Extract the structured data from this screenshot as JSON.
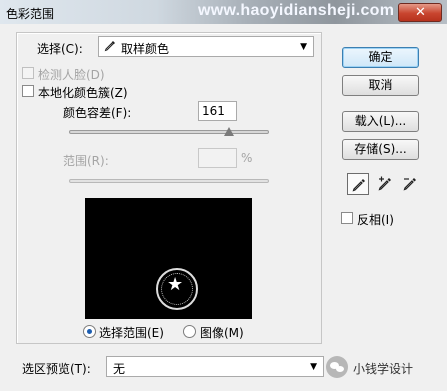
{
  "window": {
    "title": "色彩范围",
    "watermark": "www.haoyidiansheji.com",
    "close_glyph": "✕"
  },
  "select_row": {
    "label": "选择(C):",
    "value": "取样颜色",
    "icon": "eyedropper-icon"
  },
  "detect_faces": {
    "label": "检测人脸(D)",
    "checked": false,
    "enabled": false
  },
  "localized_clusters": {
    "label": "本地化颜色簇(Z)",
    "checked": false
  },
  "fuzziness": {
    "label": "颜色容差(F):",
    "value": "161",
    "slider_fraction": 0.8
  },
  "range": {
    "label": "范围(R):",
    "value": "",
    "unit": "%",
    "enabled": false
  },
  "view_mode": [
    {
      "label": "选择范围(E)",
      "selected": true
    },
    {
      "label": "图像(M)",
      "selected": false
    }
  ],
  "selection_preview": {
    "label": "选区预览(T):",
    "value": "无"
  },
  "buttons": {
    "ok": "确定",
    "cancel": "取消",
    "load": "载入(L)...",
    "save": "存储(S)..."
  },
  "tools": [
    "eyedropper-icon",
    "eyedropper-plus-icon",
    "eyedropper-minus-icon"
  ],
  "invert": {
    "label": "反相(I)",
    "checked": false
  },
  "brand": {
    "label": "小钱学设计"
  }
}
